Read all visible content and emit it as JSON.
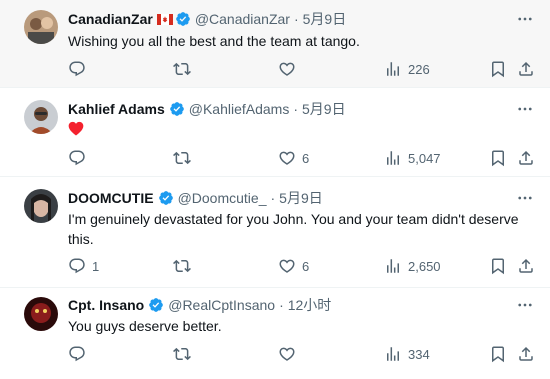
{
  "colors": {
    "verified": "#1d9bf0",
    "text": "#0f1419",
    "secondary": "#536471",
    "heart": "#f4212e",
    "hover_background": "#f7f7f7"
  },
  "tweets": [
    {
      "display_name": "CanadianZar",
      "has_flag": true,
      "flag_icon": "canada-flag-icon",
      "verified": true,
      "handle": "@CanadianZar",
      "separator": "·",
      "time": "5月9日",
      "text": "Wishing you all the best and the team at tango.",
      "replies": "",
      "retweets": "",
      "likes": "",
      "views": "226"
    },
    {
      "display_name": "Kahlief Adams",
      "verified": true,
      "handle": "@KahliefAdams",
      "separator": "·",
      "time": "5月9日",
      "text_icon": "red-heart-emoji",
      "replies": "",
      "retweets": "",
      "likes": "6",
      "views": "5,047"
    },
    {
      "display_name": "DOOMCUTIE",
      "verified": true,
      "handle": "@Doomcutie_",
      "separator": "·",
      "time": "5月9日",
      "text": "I'm genuinely devastated for you John. You and your team didn't deserve this.",
      "replies": "1",
      "retweets": "",
      "likes": "6",
      "views": "2,650"
    },
    {
      "display_name": "Cpt. Insano",
      "verified": true,
      "handle": "@RealCptInsano",
      "separator": "·",
      "time": "12小时",
      "text": "You guys deserve better.",
      "replies": "",
      "retweets": "",
      "likes": "",
      "views": "334"
    }
  ]
}
